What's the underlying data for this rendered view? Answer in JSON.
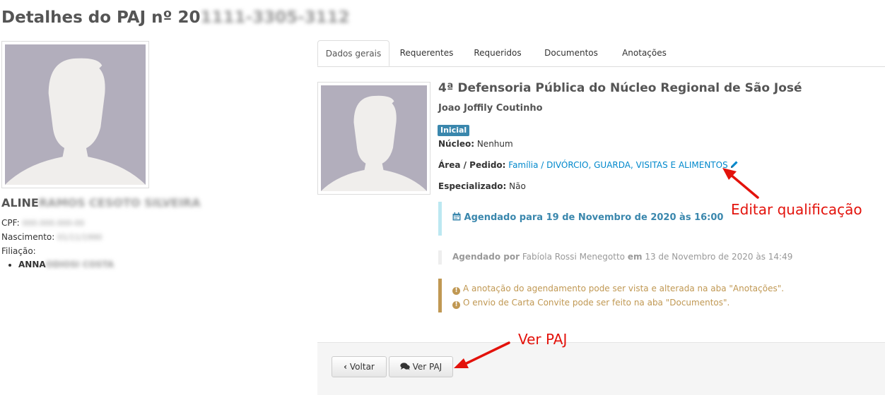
{
  "page": {
    "title_prefix": "Detalhes do PAJ nº 20",
    "title_blurred": "1111-3305-3112"
  },
  "person": {
    "name_prefix": "ALINE",
    "name_blurred": "RAMOS CESOTO SILVEIRA",
    "cpf_label": "CPF:",
    "cpf_blurred": "000.000.000-00",
    "nascimento_label": "Nascimento:",
    "nascimento_blurred": "01/11/1990",
    "filiacao_label": "Filiação:",
    "filiacao": [
      {
        "prefix": "ANNA",
        "blurred": "ODIOSI COSTA"
      }
    ]
  },
  "tabs": [
    {
      "label": "Dados gerais",
      "active": true
    },
    {
      "label": "Requerentes",
      "active": false
    },
    {
      "label": "Requeridos",
      "active": false
    },
    {
      "label": "Documentos",
      "active": false
    },
    {
      "label": "Anotações",
      "active": false
    }
  ],
  "details": {
    "title": "4ª Defensoria Pública do Núcleo Regional de São José",
    "defensor": "Joao Joffily Coutinho",
    "badge": "Inicial",
    "nucleo_label": "Núcleo:",
    "nucleo_value": "Nenhum",
    "area_label": "Área / Pedido:",
    "area_value": "Família / DIVÓRCIO, GUARDA, VISITAS E ALIMENTOS",
    "especializado_label": "Especializado:",
    "especializado_value": "Não"
  },
  "schedule": {
    "headline": "Agendado para 19 de Novembro de 2020 às 16:00",
    "by_label": "Agendado por",
    "by_name": "Fabíola Rossi Menegotto",
    "on_label": "em",
    "on_value": "13 de Novembro de 2020 às 14:49"
  },
  "notices": [
    "A anotação do agendamento pode ser vista e alterada na aba \"Anotações\".",
    "O envio de Carta Convite pode ser feito na aba \"Documentos\"."
  ],
  "buttons": {
    "back": "Voltar",
    "view_paj": "Ver PAJ"
  },
  "annotations": {
    "edit": "Editar qualificação",
    "view": "Ver PAJ"
  },
  "colors": {
    "badge": "#3a87ad",
    "link": "#0088cc",
    "warning": "#c09853",
    "annotation": "#e3120b"
  }
}
